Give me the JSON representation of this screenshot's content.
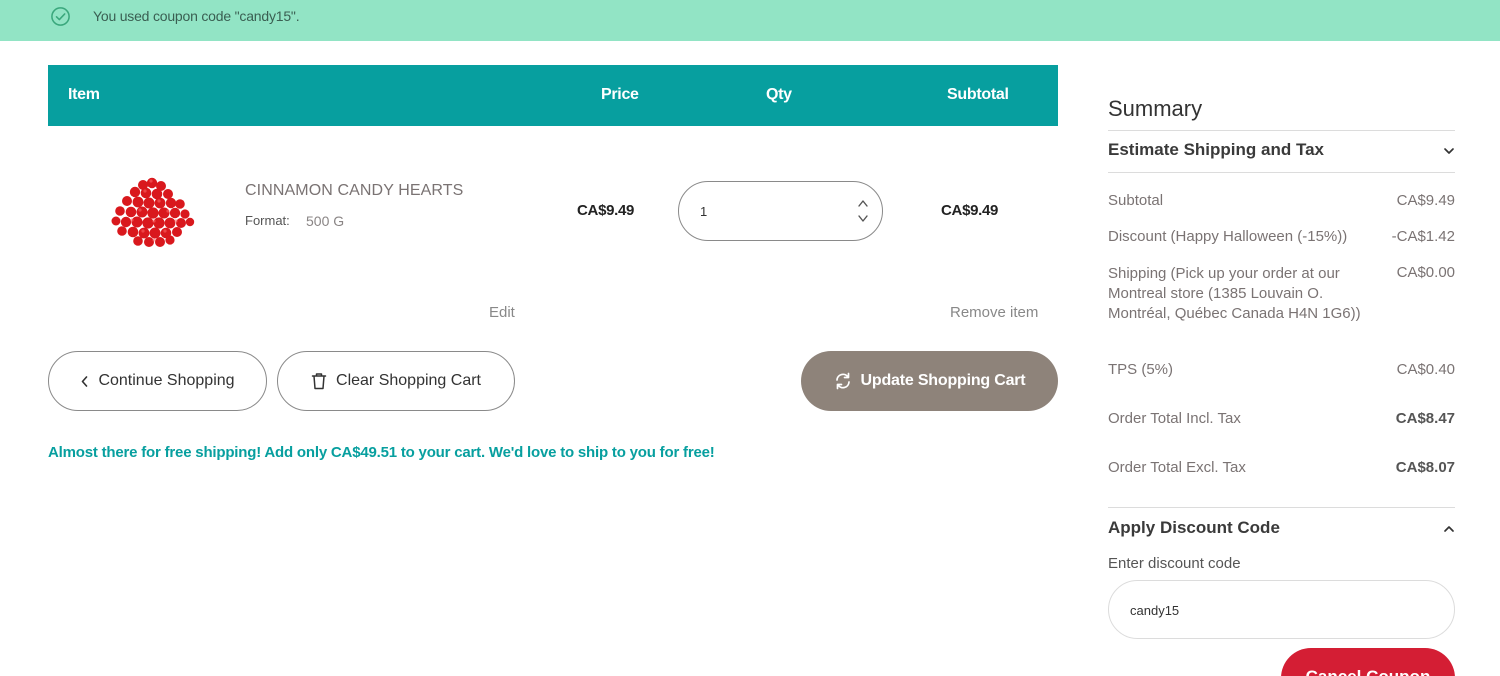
{
  "notice": {
    "message": "You used coupon code \"candy15\"."
  },
  "cart": {
    "headers": {
      "item": "Item",
      "price": "Price",
      "qty": "Qty",
      "subtotal": "Subtotal"
    },
    "product": {
      "name": "CINNAMON CANDY HEARTS",
      "format_label": "Format:",
      "format_value": "500 G",
      "price": "CA$9.49",
      "qty": "1",
      "subtotal": "CA$9.49"
    },
    "edit_label": "Edit",
    "remove_label": "Remove item",
    "continue_label": "Continue Shopping",
    "clear_label": "Clear Shopping Cart",
    "update_label": "Update Shopping Cart",
    "free_shipping_msg": "Almost there for free shipping! Add only CA$49.51 to your cart. We'd love to ship to you for free!"
  },
  "summary": {
    "title": "Summary",
    "estimate_title": "Estimate Shipping and Tax",
    "rows": {
      "subtotal": {
        "label": "Subtotal",
        "value": "CA$9.49"
      },
      "discount": {
        "label": "Discount (Happy Halloween (-15%))",
        "value": "-CA$1.42"
      },
      "shipping": {
        "label": "Shipping (Pick up your order at our Montreal store (1385 Louvain O. Montréal, Québec Canada H4N 1G6))",
        "value": "CA$0.00"
      },
      "tps": {
        "label": "TPS (5%)",
        "value": "CA$0.40"
      },
      "total_incl": {
        "label": "Order Total Incl. Tax",
        "value": "CA$8.47"
      },
      "total_excl": {
        "label": "Order Total Excl. Tax",
        "value": "CA$8.07"
      }
    },
    "discount_title": "Apply Discount Code",
    "discount_field_label": "Enter discount code",
    "discount_value": "candy15",
    "cancel_label": "Cancel Coupon"
  },
  "colors": {
    "banner": "#92e4c5",
    "teal": "#079f9f",
    "update_button": "#8e837a",
    "cancel_button": "#d41e34"
  }
}
